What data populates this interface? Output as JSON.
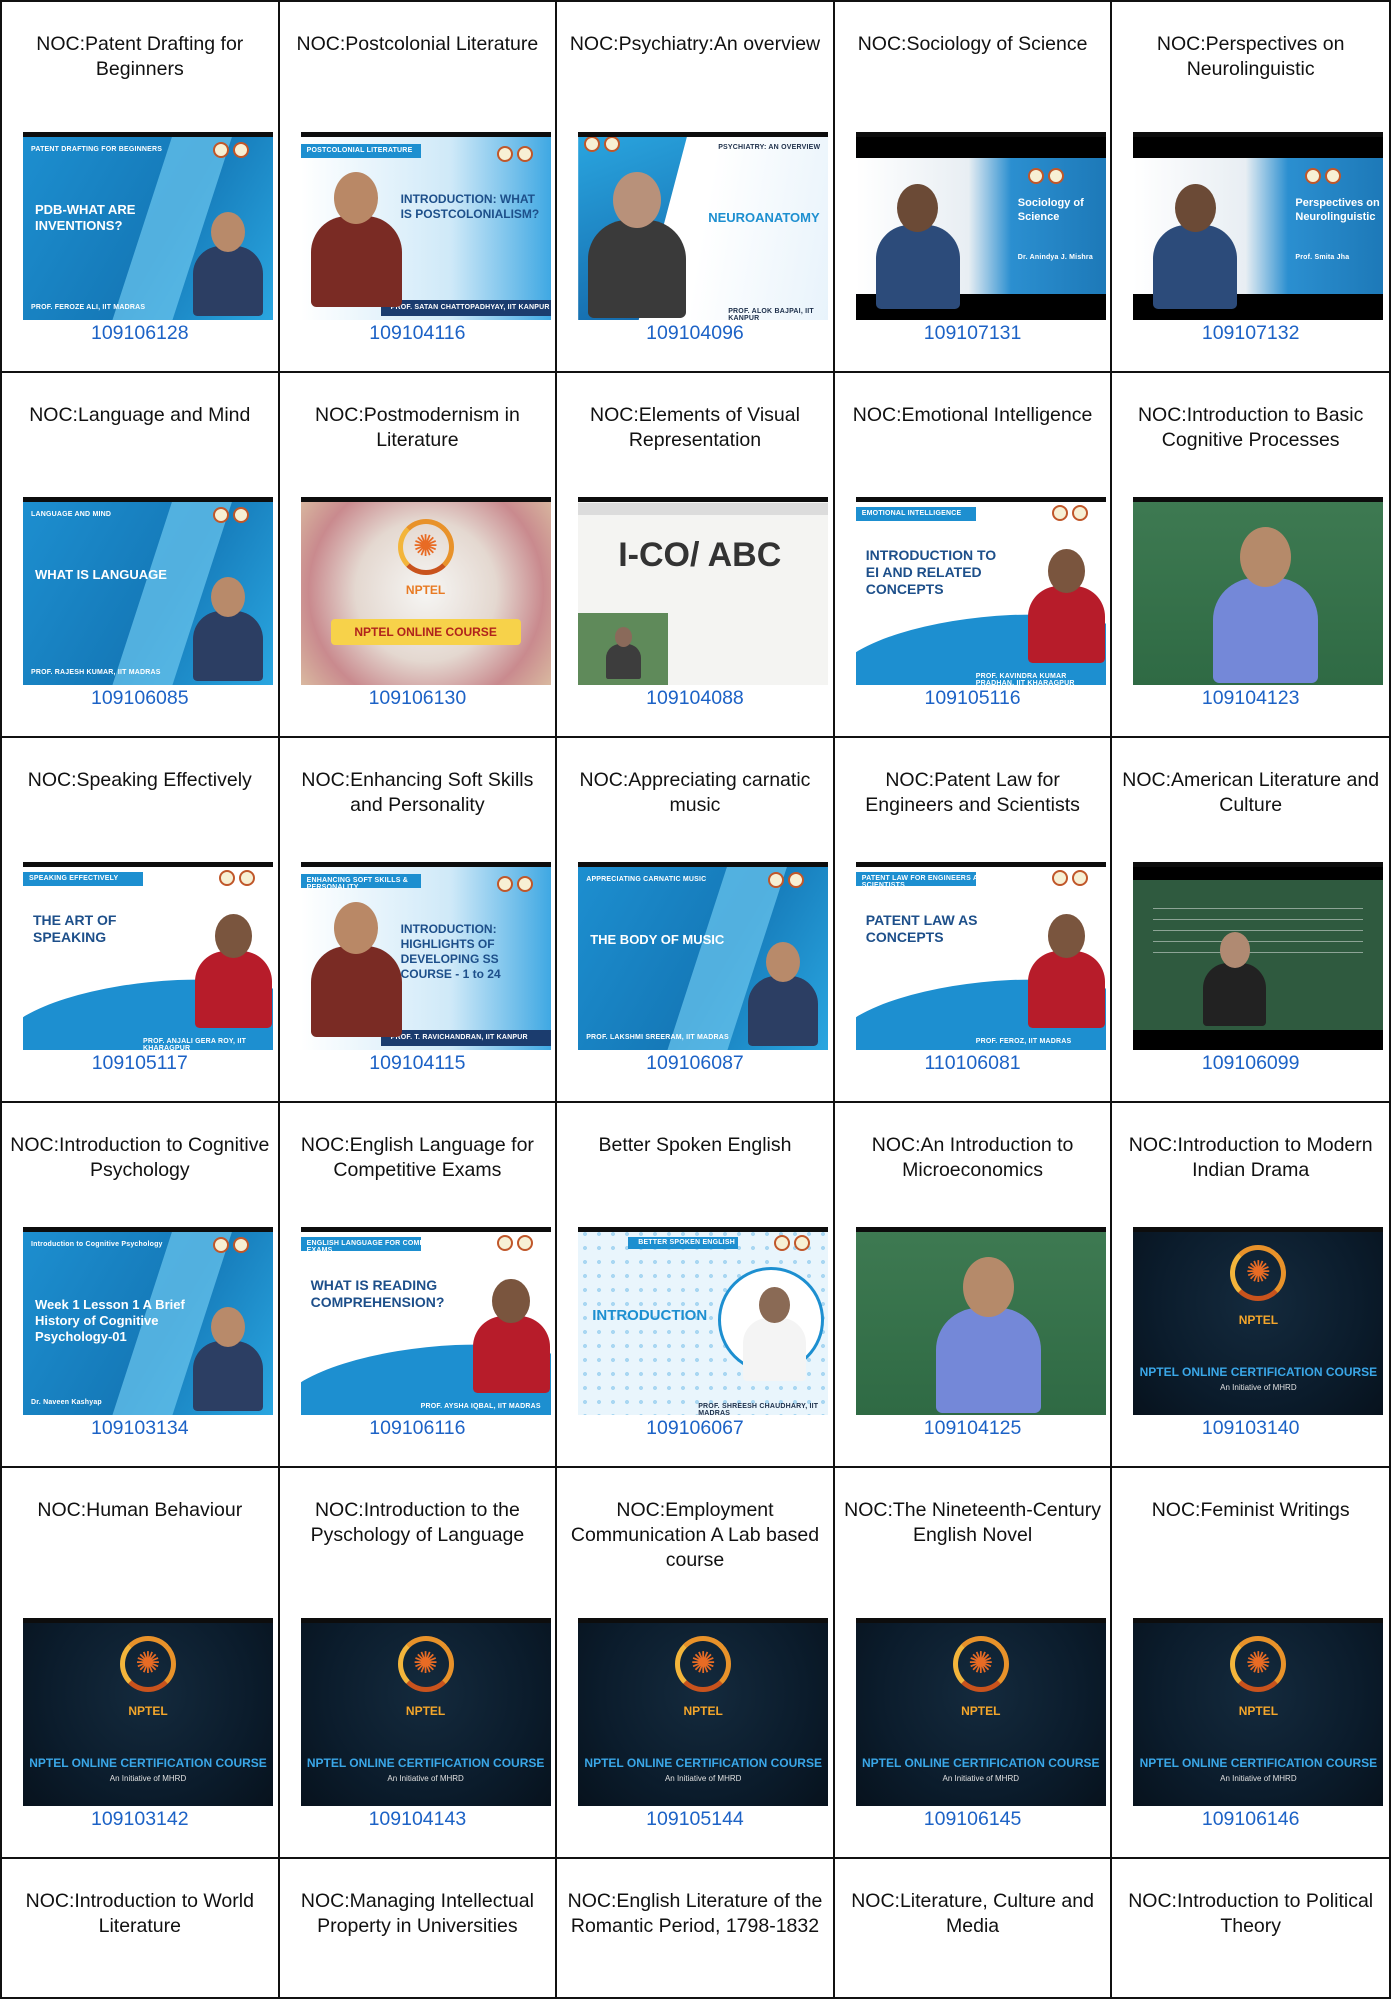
{
  "courses": [
    {
      "title": "NOC:Patent Drafting for Beginners",
      "code": "109106128",
      "thumb": {
        "style": "blue",
        "label": "PATENT DRAFTING FOR BEGINNERS",
        "text": "PDB-WHAT ARE INVENTIONS?",
        "footer": "PROF. FEROZE ALI, IIT MADRAS"
      }
    },
    {
      "title": "NOC:Postcolonial Literature",
      "code": "109104116",
      "thumb": {
        "style": "lightblue",
        "label": "POSTCOLONIAL LITERATURE",
        "text": "INTRODUCTION: WHAT IS POSTCOLONIALISM?",
        "footer": "PROF. SATAN CHATTOPADHYAY, IIT KANPUR"
      }
    },
    {
      "title": "NOC:Psychiatry:An overview",
      "code": "109104096",
      "thumb": {
        "style": "white",
        "label": "PSYCHIATRY: AN OVERVIEW",
        "text": "NEUROANATOMY",
        "footer": "PROF. ALOK BAJPAI, IIT KANPUR"
      }
    },
    {
      "title": "NOC:Sociology of Science",
      "code": "109107131",
      "thumb": {
        "style": "video",
        "label": "",
        "text": "Sociology of Science",
        "footer": "Dr. Anindya J. Mishra"
      }
    },
    {
      "title": "NOC:Perspectives on Neurolinguistic",
      "code": "109107132",
      "thumb": {
        "style": "video",
        "label": "",
        "text": "Perspectives on Neurolinguistic",
        "footer": "Prof. Smita Jha"
      }
    },
    {
      "title": "NOC:Language and Mind",
      "code": "109106085",
      "thumb": {
        "style": "blue",
        "label": "LANGUAGE AND MIND",
        "text": "WHAT IS LANGUAGE",
        "footer": "PROF. RAJESH KUMAR, IIT MADRAS"
      }
    },
    {
      "title": "NOC:Postmodernism in Literature",
      "code": "109106130",
      "thumb": {
        "style": "nptel-light",
        "label": "NPTEL",
        "text": "NPTEL ONLINE COURSE",
        "footer": ""
      }
    },
    {
      "title": "NOC:Elements of Visual Representation",
      "code": "109104088",
      "thumb": {
        "style": "whiteboard",
        "label": "",
        "text": "I-CO/ ABC",
        "footer": ""
      }
    },
    {
      "title": "NOC:Emotional Intelligence",
      "code": "109105116",
      "thumb": {
        "style": "white-blue",
        "label": "EMOTIONAL INTELLIGENCE",
        "text": "INTRODUCTION TO EI AND RELATED CONCEPTS",
        "footer": "PROF. KAVINDRA KUMAR PRADHAN, IIT KHARAGPUR"
      }
    },
    {
      "title": "NOC:Introduction to Basic Cognitive Processes",
      "code": "109104123",
      "thumb": {
        "style": "green",
        "label": "",
        "text": "",
        "footer": ""
      }
    },
    {
      "title": "NOC:Speaking Effectively",
      "code": "109105117",
      "thumb": {
        "style": "white-blue",
        "label": "SPEAKING EFFECTIVELY",
        "text": "THE ART OF SPEAKING",
        "footer": "PROF. ANJALI GERA ROY, IIT KHARAGPUR"
      }
    },
    {
      "title": "NOC:Enhancing Soft Skills and Personality",
      "code": "109104115",
      "thumb": {
        "style": "lightblue",
        "label": "ENHANCING SOFT SKILLS & PERSONALITY",
        "text": "INTRODUCTION: HIGHLIGHTS OF DEVELOPING SS COURSE - 1 to 24",
        "footer": "PROF. T. RAVICHANDRAN, IIT KANPUR"
      }
    },
    {
      "title": "NOC:Appreciating carnatic music",
      "code": "109106087",
      "thumb": {
        "style": "blue",
        "label": "APPRECIATING CARNATIC MUSIC",
        "text": "THE BODY OF MUSIC",
        "footer": "PROF. LAKSHMI SREERAM, IIT MADRAS"
      }
    },
    {
      "title": "NOC:Patent Law for Engineers and Scientists",
      "code": "110106081",
      "thumb": {
        "style": "white-blue",
        "label": "PATENT LAW FOR ENGINEERS AND SCIENTISTS",
        "text": "PATENT LAW AS CONCEPTS",
        "footer": "PROF. FEROZ, IIT MADRAS"
      }
    },
    {
      "title": "NOC:American Literature and Culture",
      "code": "109106099",
      "thumb": {
        "style": "chalkboard",
        "label": "",
        "text": "",
        "footer": ""
      }
    },
    {
      "title": "NOC:Introduction to Cognitive Psychology",
      "code": "109103134",
      "thumb": {
        "style": "blue",
        "label": "Introduction to Cognitive Psychology",
        "text": "Week 1 Lesson 1 A Brief History of Cognitive Psychology-01",
        "footer": "Dr. Naveen Kashyap"
      }
    },
    {
      "title": "NOC:English Language for Competitive Exams",
      "code": "109106116",
      "thumb": {
        "style": "white-blue",
        "label": "ENGLISH LANGUAGE FOR COMPETITIVE EXAMS",
        "text": "WHAT IS READING COMPREHENSION?",
        "footer": "PROF. AYSHA IQBAL, IIT MADRAS"
      }
    },
    {
      "title": "Better Spoken English",
      "code": "109106067",
      "thumb": {
        "style": "dots",
        "label": "BETTER SPOKEN ENGLISH",
        "text": "INTRODUCTION",
        "footer": "PROF. SHREESH CHAUDHARY, IIT MADRAS"
      }
    },
    {
      "title": "NOC:An Introduction to Microeconomics",
      "code": "109104125",
      "thumb": {
        "style": "green",
        "label": "",
        "text": "",
        "footer": ""
      }
    },
    {
      "title": "NOC:Introduction to Modern Indian Drama",
      "code": "109103140",
      "thumb": {
        "style": "nptel-dark",
        "label": "NPTEL",
        "text": "NPTEL ONLINE CERTIFICATION COURSE",
        "footer": "An Initiative of MHRD"
      }
    },
    {
      "title": "NOC:Human Behaviour",
      "code": "109103142",
      "thumb": {
        "style": "nptel-dark",
        "label": "NPTEL",
        "text": "NPTEL ONLINE CERTIFICATION COURSE",
        "footer": "An Initiative of MHRD"
      }
    },
    {
      "title": "NOC:Introduction to the Pyschology of Language",
      "code": "109104143",
      "thumb": {
        "style": "nptel-dark",
        "label": "NPTEL",
        "text": "NPTEL ONLINE CERTIFICATION COURSE",
        "footer": "An Initiative of MHRD"
      }
    },
    {
      "title": "NOC:Employment Communication A Lab based course",
      "code": "109105144",
      "thumb": {
        "style": "nptel-dark",
        "label": "NPTEL",
        "text": "NPTEL ONLINE CERTIFICATION COURSE",
        "footer": "An Initiative of MHRD"
      }
    },
    {
      "title": "NOC:The Nineteenth-Century English Novel",
      "code": "109106145",
      "thumb": {
        "style": "nptel-dark",
        "label": "NPTEL",
        "text": "NPTEL ONLINE CERTIFICATION COURSE",
        "footer": "An Initiative of MHRD"
      }
    },
    {
      "title": "NOC:Feminist Writings",
      "code": "109106146",
      "thumb": {
        "style": "nptel-dark",
        "label": "NPTEL",
        "text": "NPTEL ONLINE CERTIFICATION COURSE",
        "footer": "An Initiative of MHRD"
      }
    },
    {
      "title": "NOC:Introduction to World Literature",
      "code": "",
      "thumb": null
    },
    {
      "title": "NOC:Managing Intellectual Property in Universities",
      "code": "",
      "thumb": null
    },
    {
      "title": "NOC:English Literature of the Romantic Period, 1798-1832",
      "code": "",
      "thumb": null
    },
    {
      "title": "NOC:Literature, Culture and Media",
      "code": "",
      "thumb": null
    },
    {
      "title": "NOC:Introduction to Political Theory",
      "code": "",
      "thumb": null
    }
  ],
  "colors": {
    "link": "#1c62c6",
    "border": "#111111",
    "nptel_bg": "#0b1c2c",
    "blue": "#1d8fd0"
  }
}
